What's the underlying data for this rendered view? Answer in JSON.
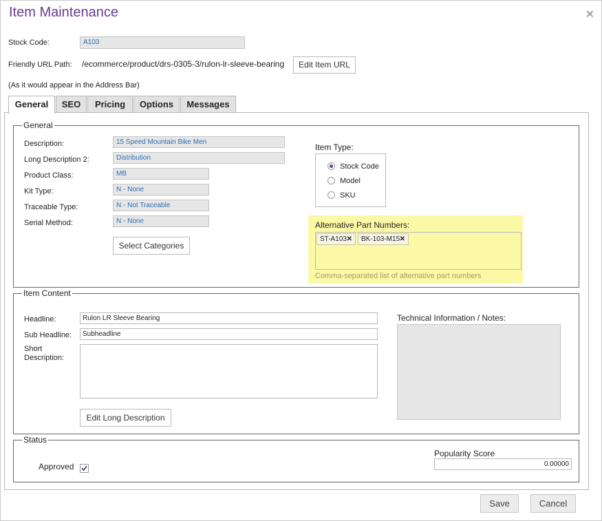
{
  "window": {
    "title": "Item Maintenance"
  },
  "header": {
    "stock_code_label": "Stock Code:",
    "stock_code_value": "A103",
    "friendly_url_label": "Friendly URL Path:",
    "friendly_url_value": "/ecommerce/product/drs-0305-3/rulon-lr-sleeve-bearing",
    "edit_url_button": "Edit Item URL",
    "address_bar_note": "(As it would appear in the Address Bar)"
  },
  "tabs": [
    {
      "label": "General",
      "active": true
    },
    {
      "label": "SEO"
    },
    {
      "label": "Pricing"
    },
    {
      "label": "Options"
    },
    {
      "label": "Messages"
    }
  ],
  "general": {
    "legend": "General",
    "description_label": "Description:",
    "description_value": "15 Speed Mountain Bike Men",
    "long_desc2_label": "Long Description 2:",
    "long_desc2_value": "Distribution",
    "product_class_label": "Product Class:",
    "product_class_value": "MB",
    "kit_type_label": "Kit Type:",
    "kit_type_value": "N - None",
    "traceable_label": "Traceable Type:",
    "traceable_value": "N - Not Traceable",
    "serial_label": "Serial Method:",
    "serial_value": "N - None",
    "select_categories_button": "Select Categories",
    "item_type_label": "Item Type:",
    "item_type_options": [
      "Stock Code",
      "Model",
      "SKU"
    ],
    "item_type_selected": "Stock Code",
    "alt_parts_label": "Alternative Part Numbers:",
    "alt_parts": [
      "ST-A103",
      "BK-103-M15"
    ],
    "alt_parts_help": "Comma-separated list of alternative part numbers"
  },
  "content": {
    "legend": "Item Content",
    "headline_label": "Headline:",
    "headline_value": "Rulon LR Sleeve Bearing",
    "sub_headline_label": "Sub Headline:",
    "sub_headline_value": "Subheadline",
    "short_desc_label_1": "Short",
    "short_desc_label_2": "Description:",
    "edit_long_desc_button": "Edit Long Description",
    "tech_info_label": "Technical Information / Notes:"
  },
  "status": {
    "legend": "Status",
    "approved_label": "Approved",
    "approved_checked": true,
    "popularity_label": "Popularity Score",
    "popularity_value": "0.00000"
  },
  "footer": {
    "save": "Save",
    "cancel": "Cancel"
  },
  "colors": {
    "accent": "#6a3a8c",
    "highlight": "#fbf8a6",
    "readonly_text": "#2a6ebb"
  }
}
